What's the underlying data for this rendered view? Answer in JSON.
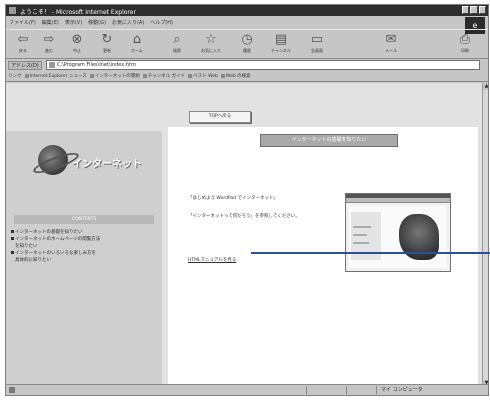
{
  "window": {
    "title": "ようこそ！ - Microsoft Internet Explorer",
    "menu": [
      "ファイル(F)",
      "編集(E)",
      "表示(V)",
      "移動(G)",
      "お気に入り(A)",
      "ヘルプ(H)"
    ],
    "toolbar": [
      {
        "icon": "back-icon",
        "label": "戻る"
      },
      {
        "icon": "forward-icon",
        "label": "進む"
      },
      {
        "icon": "stop-icon",
        "label": "中止"
      },
      {
        "icon": "refresh-icon",
        "label": "更新"
      },
      {
        "icon": "home-icon",
        "label": "ホーム"
      },
      {
        "icon": "search-icon",
        "label": "検索"
      },
      {
        "icon": "favorites-icon",
        "label": "お気に入り"
      },
      {
        "icon": "history-icon",
        "label": "履歴"
      },
      {
        "icon": "channels-icon",
        "label": "チャンネル"
      },
      {
        "icon": "fullscreen-icon",
        "label": "全画面"
      },
      {
        "icon": "mail-icon",
        "label": "メール"
      },
      {
        "icon": "print-icon",
        "label": "印刷"
      }
    ]
  },
  "address": {
    "label": "アドレス(D)",
    "value": "C:\\Program Files\\Inet\\index.htm"
  },
  "links": {
    "label": "リンク",
    "items": [
      "Internet Explorer ニュース",
      "インターネットの開始",
      "チャンネル ガイド",
      "ベスト Web",
      "Web の検索"
    ]
  },
  "page": {
    "top_button": "TOPへ戻る",
    "logo_text": "インターネット",
    "nav_header": "CONTENTS",
    "nav_items": [
      {
        "label": "インターネットの基礎を知りたい"
      },
      {
        "label": "インターネットのホームページの閲覧方法",
        "sub": "を知りたい"
      },
      {
        "label": "インターネットのいろいろな楽しみ方を",
        "sub": "具体的に知りたい"
      }
    ],
    "panel_header": "インターネットの基礎を知りたい",
    "p1": "「はじめよう WordPad でインターネット」",
    "p2": "「インターネットって何だろう」を参照してください。",
    "link": "HTMLマニュアルを見る"
  },
  "status": {
    "zone": "マイ コンピュータ"
  },
  "colors": {
    "callout": "#2b4fa0"
  }
}
